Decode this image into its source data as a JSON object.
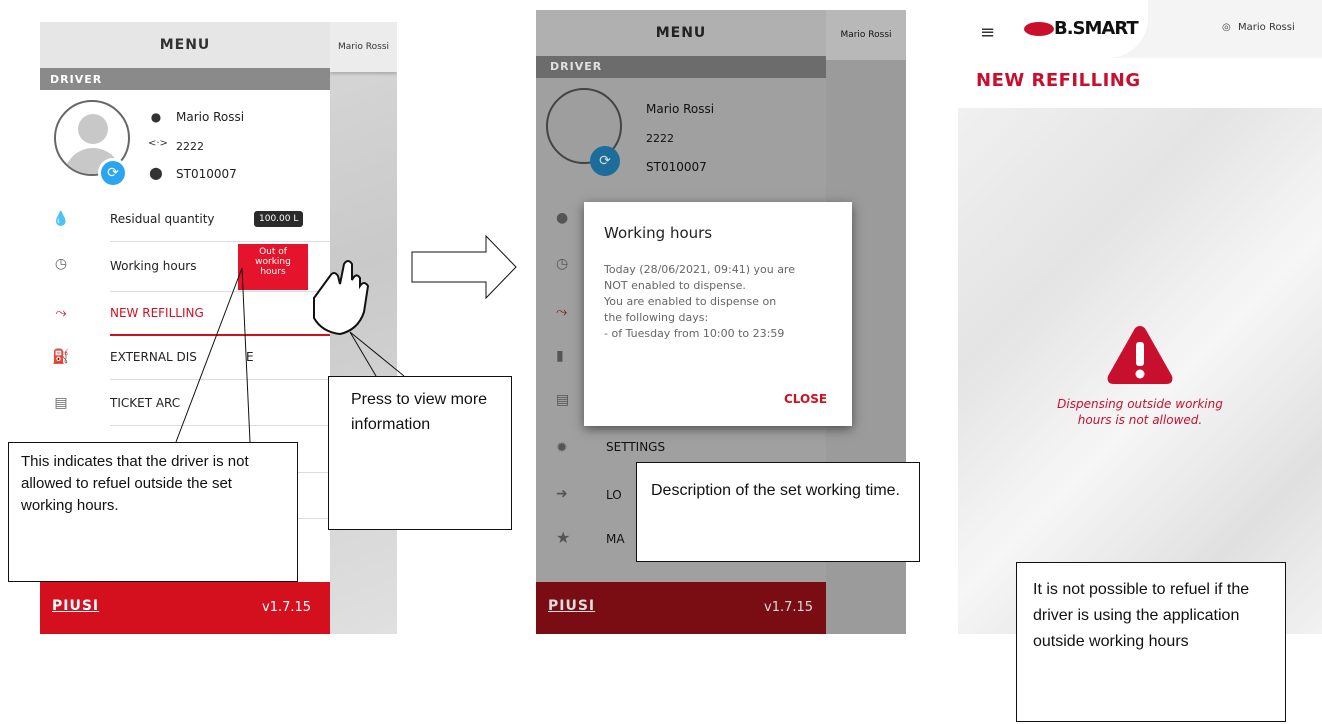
{
  "panel1": {
    "user_name_right": "Mario Rossi",
    "menu_title": "MENU",
    "section": "DRIVER",
    "driver": {
      "name": "Mario Rossi",
      "code": "2222",
      "station": "ST010007"
    },
    "rows": [
      {
        "label": "Residual quantity",
        "badge": "100.00 L",
        "icon": "drop-icon"
      },
      {
        "label": "Working hours",
        "badge": "Out of working hours",
        "icon": "clock-icon"
      },
      {
        "label": "NEW REFILLING",
        "icon": "fuel-nozzle-icon"
      },
      {
        "label": "EXTERNAL DIS",
        "label_tail": "E",
        "icon": "fuel-pump-icon"
      },
      {
        "label": "TICKET ARC",
        "icon": "ticket-icon"
      }
    ],
    "footer": {
      "brand": "PIUSI",
      "version": "v1.7.15"
    }
  },
  "callouts": {
    "indicates": "This indicates that the driver is not allowed to refuel outside the set working hours.",
    "press": "Press to view more information",
    "description": "Description of the set working time.",
    "not_possible": "It is not possible to refuel if the driver is using the application outside working hours"
  },
  "panel2": {
    "user_name_right": "Mario Rossi",
    "menu_title": "MENU",
    "section": "DRIVER",
    "driver": {
      "name": "Mario Rossi",
      "code": "2222",
      "station": "ST010007"
    },
    "rows": [
      {
        "label": "SETTINGS",
        "icon": "gear-icon"
      },
      {
        "label": "LO",
        "icon": "logout-icon"
      },
      {
        "label": "MA",
        "icon": "star-icon"
      }
    ],
    "dialog": {
      "title": "Working hours",
      "lines": [
        "Today (28/06/2021, 09:41) you are",
        "NOT enabled to dispense.",
        "You are enabled to dispense on",
        "the following days:",
        "- of Tuesday from 10:00 to 23:59"
      ],
      "close": "CLOSE"
    },
    "footer": {
      "brand": "PIUSI",
      "version": "v1.7.15"
    }
  },
  "panel3": {
    "logo": "B.SMART",
    "user": "Mario Rossi",
    "title": "NEW REFILLING",
    "warning_text": [
      "Dispensing outside working",
      "hours is not allowed."
    ],
    "colors": {
      "red": "#c8102e"
    }
  }
}
